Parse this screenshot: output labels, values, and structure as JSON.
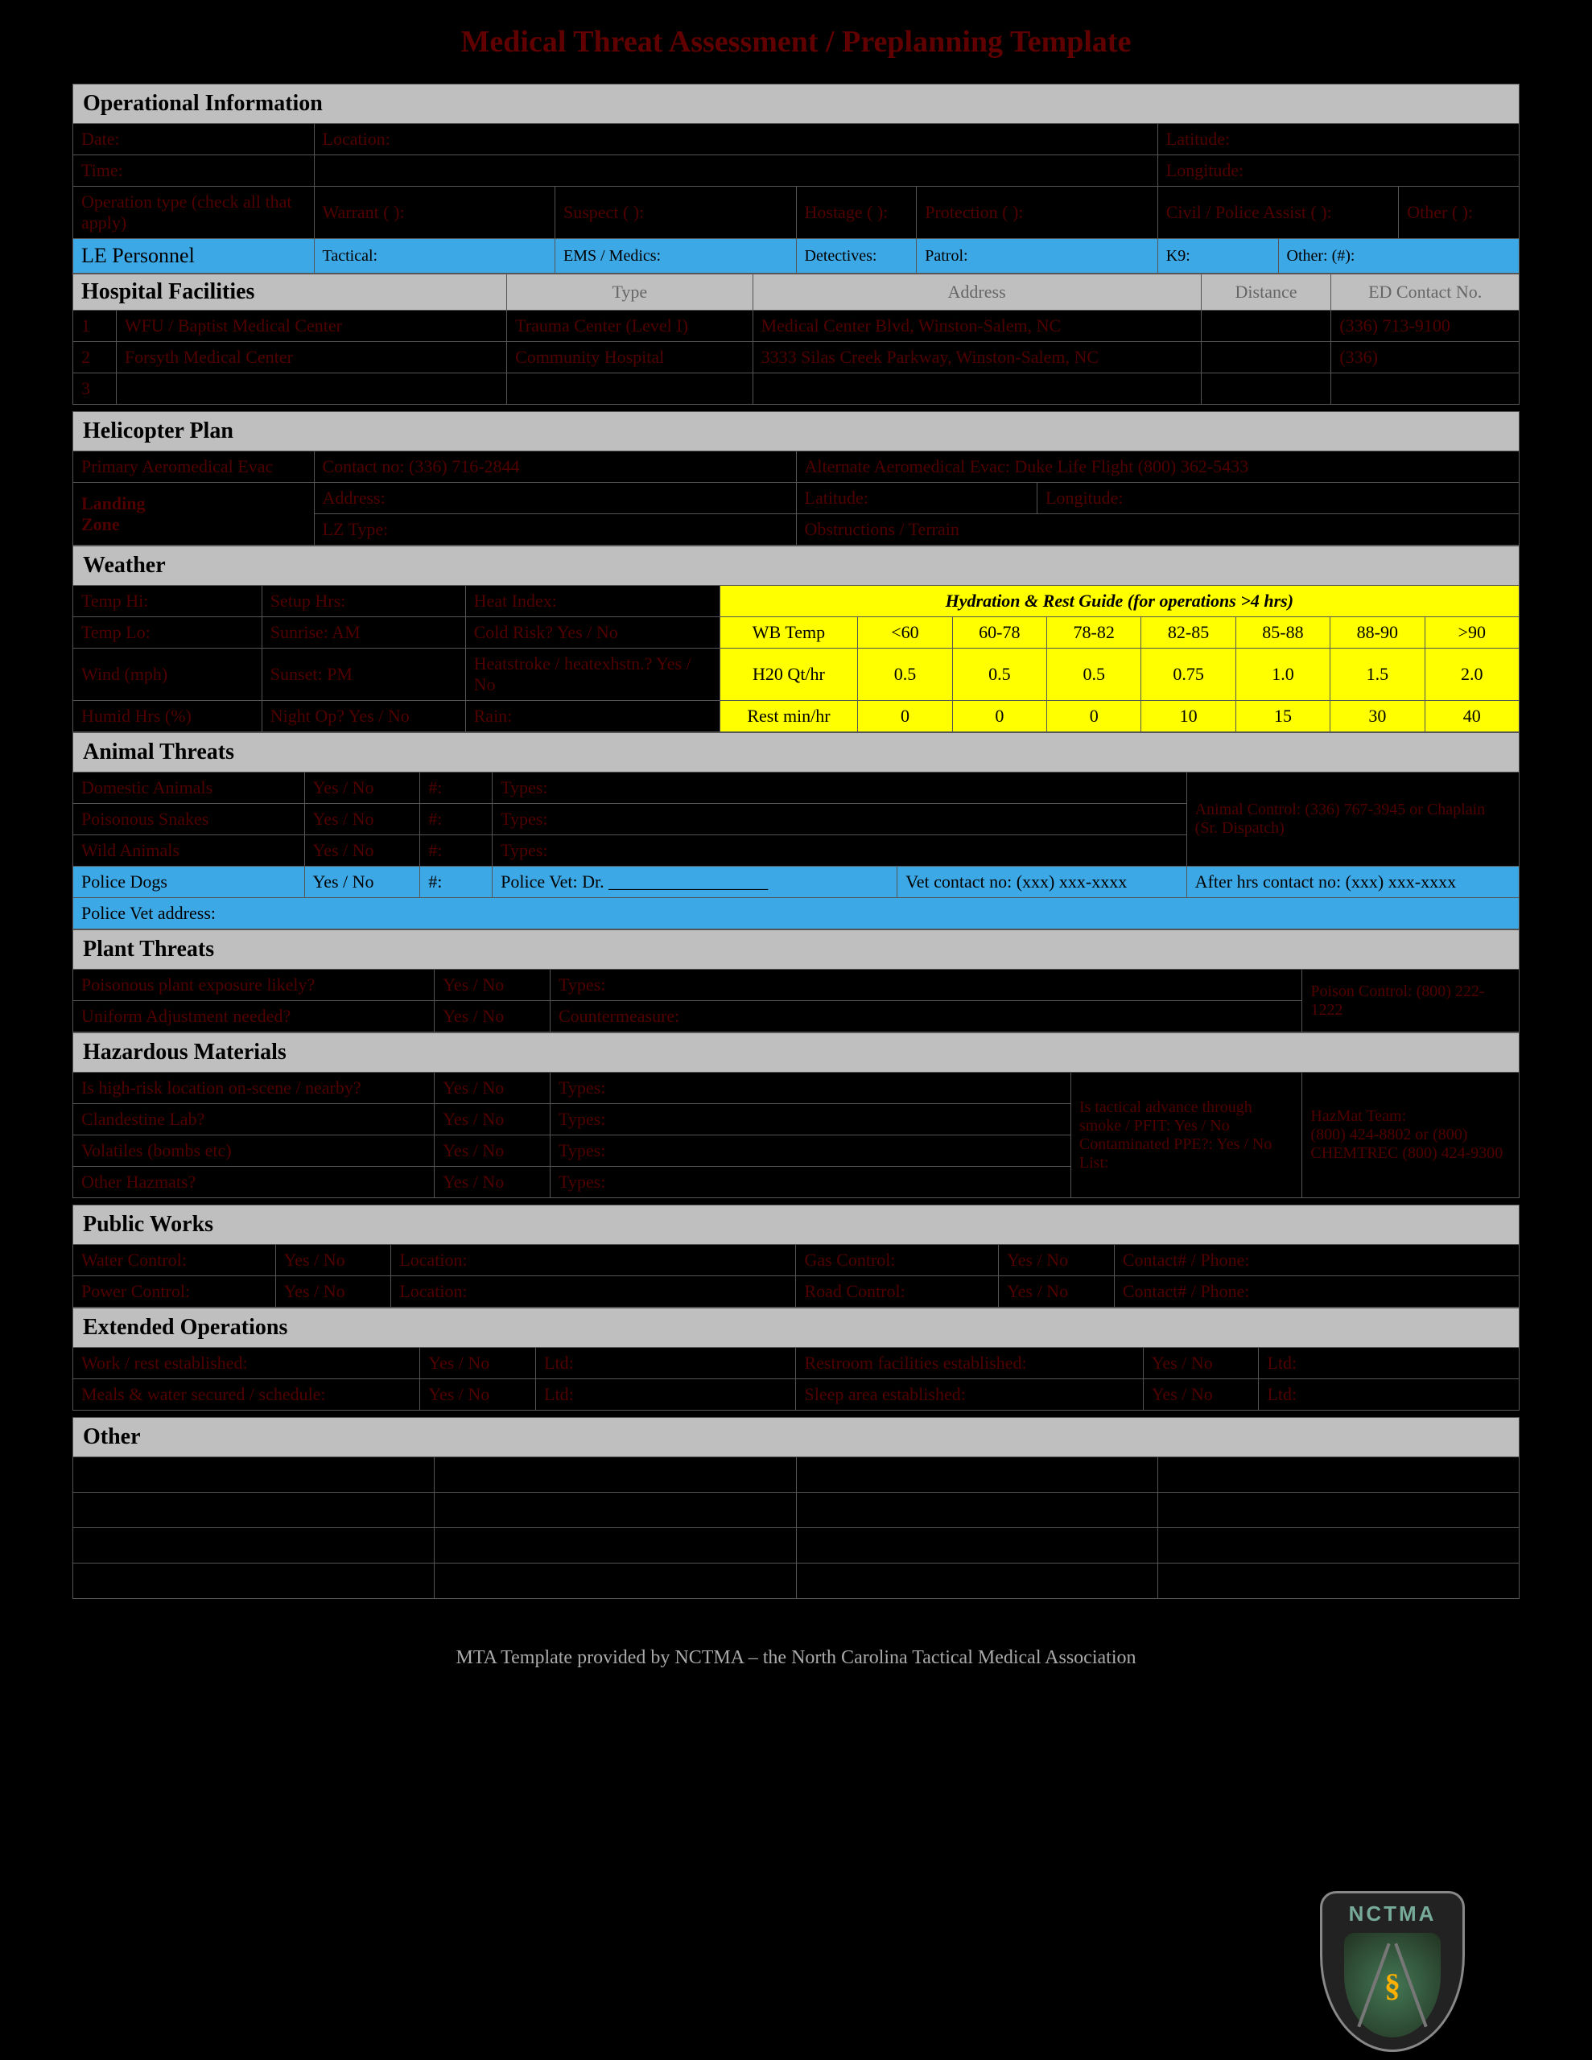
{
  "title": "Medical Threat Assessment / Preplanning Template",
  "footer": "MTA Template provided by NCTMA – the North Carolina Tactical Medical Association",
  "logo_text": "NCTMA",
  "sections": {
    "operational": "Operational Information",
    "le_personnel": "LE Personnel",
    "hospital": "Hospital Facilities",
    "helicopter": "Helicopter Plan",
    "weather": "Weather",
    "animal": "Animal Threats",
    "plant": "Plant Threats",
    "hazmat": "Hazardous Materials",
    "publicworks": "Public Works",
    "extended": "Extended Operations",
    "other": "Other"
  },
  "op": {
    "date": "Date:",
    "location": "Location:",
    "latitude": "Latitude:",
    "time": "Time:",
    "longitude": "Longitude:",
    "type": "Operation type (check all that apply)",
    "warrant": "Warrant ( ):",
    "suspect": "Suspect ( ):",
    "hostage": "Hostage ( ):",
    "protection": "Protection ( ):",
    "civil": "Civil / Police Assist ( ):",
    "other": "Other ( ):"
  },
  "le": {
    "tactical": "Tactical:",
    "ems": "EMS / Medics:",
    "detectives": "Detectives:",
    "patrol": "Patrol:",
    "k9": "K9:",
    "other": "Other: (#):"
  },
  "hosp_hdrs": {
    "type": "Type",
    "address": "Address",
    "distance": "Distance",
    "ed": "ED Contact No."
  },
  "hosp": [
    {
      "n": "1",
      "name": "WFU / Baptist Medical Center",
      "type": "Trauma Center (Level I)",
      "address": "Medical Center Blvd, Winston-Salem, NC",
      "distance": "",
      "ed": "(336) 713-9100"
    },
    {
      "n": "2",
      "name": "Forsyth Medical Center",
      "type": "Community Hospital",
      "address": "3333 Silas Creek Parkway, Winston-Salem, NC",
      "distance": "",
      "ed": "(336)"
    },
    {
      "n": "3",
      "name": "",
      "type": "",
      "address": "",
      "distance": "",
      "ed": ""
    }
  ],
  "heli": {
    "primary": "Primary Aeromedical Evac",
    "contact_label": "Contact no: (336) 716-2844",
    "alternate": "Alternate Aeromedical Evac: Duke Life Flight (800) 362-5433",
    "landing": "Landing",
    "zone": "Zone",
    "address": "Address:",
    "latitude": "Latitude:",
    "longitude": "Longitude:",
    "lztype": "LZ Type:",
    "obstructions": "Obstructions / Terrain"
  },
  "weather": {
    "temp_hi": "Temp Hi:",
    "temp_lo": "Temp Lo:",
    "setup_hrs": "Setup Hrs:",
    "sunrise": "Sunrise:              AM",
    "sunset": "Sunset:              PM",
    "heat_index": "Heat Index:",
    "cold_risk": "Cold Risk?  Yes / No",
    "wind": "Wind (mph)",
    "heat_risk": "Heatstroke / heatexhstn.?  Yes / No",
    "humid_hrs": "Humid Hrs (%)",
    "night_op": "Night Op? Yes / No",
    "rain": "Rain:"
  },
  "hydration": {
    "title": "Hydration & Rest Guide (for operations >4 hrs)",
    "row_labels": [
      "WB Temp",
      "H20 Qt/hr",
      "Rest min/hr"
    ],
    "cols": [
      "<60",
      "60-78",
      "78-82",
      "82-85",
      "85-88",
      "88-90",
      ">90"
    ],
    "h20": [
      "0.5",
      "0.5",
      "0.5",
      "0.75",
      "1.0",
      "1.5",
      "2.0"
    ],
    "rest": [
      "0",
      "0",
      "0",
      "10",
      "15",
      "30",
      "40"
    ]
  },
  "animal": {
    "domestic": "Domestic Animals",
    "poisonous": "Poisonous Snakes",
    "wild": "Wild Animals",
    "yesno": "Yes / No",
    "num": "#:",
    "types": "Types:",
    "animal_control": "Animal Control: (336) 767-3945   or   Chaplain (Sr. Dispatch)",
    "police_dogs": "Police Dogs",
    "police_vet": "Police Vet: Dr. __________________",
    "vet_contact": "Vet contact no: (xxx) xxx-xxxx",
    "after_hrs": "After hrs contact no: (xxx) xxx-xxxx",
    "vet_addr": "Police Vet address:"
  },
  "plant": {
    "poisonous": "Poisonous plant exposure likely?",
    "uniform": "Uniform Adjustment needed?",
    "yesno": "Yes / No",
    "types": "Types:",
    "countermeasure": "Countermeasure:",
    "poison_control": "Poison Control: (800) 222-1222"
  },
  "hazmat": {
    "highrisk": "Is high-risk location on-scene / nearby?",
    "clandestine": "Clandestine Lab?",
    "volatiles": "Volatiles (bombs etc)",
    "other": "Other Hazmats?",
    "yesno": "Yes / No",
    "types": "Types:",
    "tactical_risk": "Is tactical advance through smoke / PFIT:  Yes / No  Contaminated PPE?:  Yes / No   List:",
    "hazmat_team": "HazMat Team:",
    "hazmat_contact": "(800) 424-8802 or (800) CHEMTREC (800) 424-9300"
  },
  "publicworks": {
    "water": "Water Control:",
    "gas": "Gas Control:",
    "power": "Power Control:",
    "road": "Road Control:",
    "yesno": "Yes / No",
    "location": "Location:",
    "contact_phone": "Contact# / Phone:"
  },
  "extended": {
    "work": "Work / rest established:",
    "meals": "Meals & water secured / schedule:",
    "restroom": "Restroom facilities established:",
    "sleep": "Sleep area established:",
    "yesno": "Yes / No",
    "ltd": "Ltd:"
  }
}
